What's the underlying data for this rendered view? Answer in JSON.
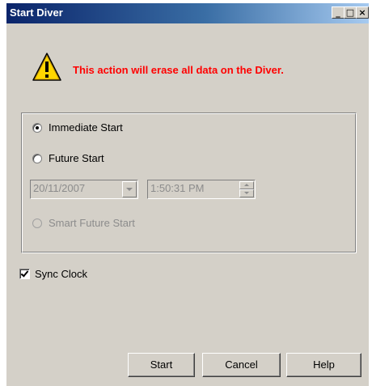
{
  "window": {
    "title": "Start Diver",
    "controls": {
      "minimize_glyph": "_",
      "maximize_glyph": "□",
      "close_glyph": "×"
    }
  },
  "warning": {
    "icon": "warning-triangle-icon",
    "message": "This action will erase all data on the Diver.",
    "color": "#ff0000"
  },
  "start_options": {
    "immediate": {
      "label": "Immediate Start",
      "selected": true,
      "enabled": true
    },
    "future": {
      "label": "Future Start",
      "selected": false,
      "enabled": true
    },
    "date": {
      "value": "20/11/2007",
      "enabled": false
    },
    "time": {
      "value": "1:50:31 PM",
      "enabled": false
    },
    "smart_future": {
      "label": "Smart Future Start",
      "selected": false,
      "enabled": false
    }
  },
  "sync_clock": {
    "label": "Sync Clock",
    "checked": true
  },
  "buttons": {
    "start": "Start",
    "cancel": "Cancel",
    "help": "Help"
  }
}
